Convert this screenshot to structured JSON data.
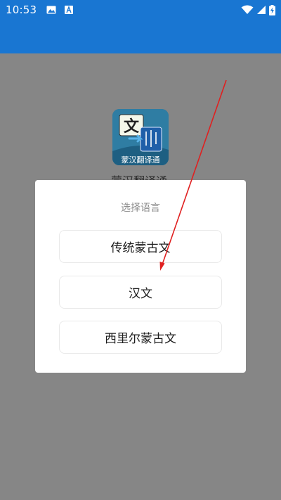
{
  "status_bar": {
    "time": "10:53",
    "left_icons": [
      "image-icon",
      "text-a-icon"
    ],
    "right_icons": [
      "wifi-icon",
      "cellular-signal-icon",
      "battery-charging-icon"
    ]
  },
  "colors": {
    "primary": "#1976D2",
    "scrim": "#868686",
    "annotation_arrow": "#E02020"
  },
  "app": {
    "icon_glyph": "文",
    "icon_label": "蒙汉翻译通",
    "name_peek": "蒙汉翻译通"
  },
  "dialog": {
    "title": "选择语言",
    "options": [
      {
        "label": "传统蒙古文"
      },
      {
        "label": "汉文"
      },
      {
        "label": "西里尔蒙古文"
      }
    ]
  }
}
